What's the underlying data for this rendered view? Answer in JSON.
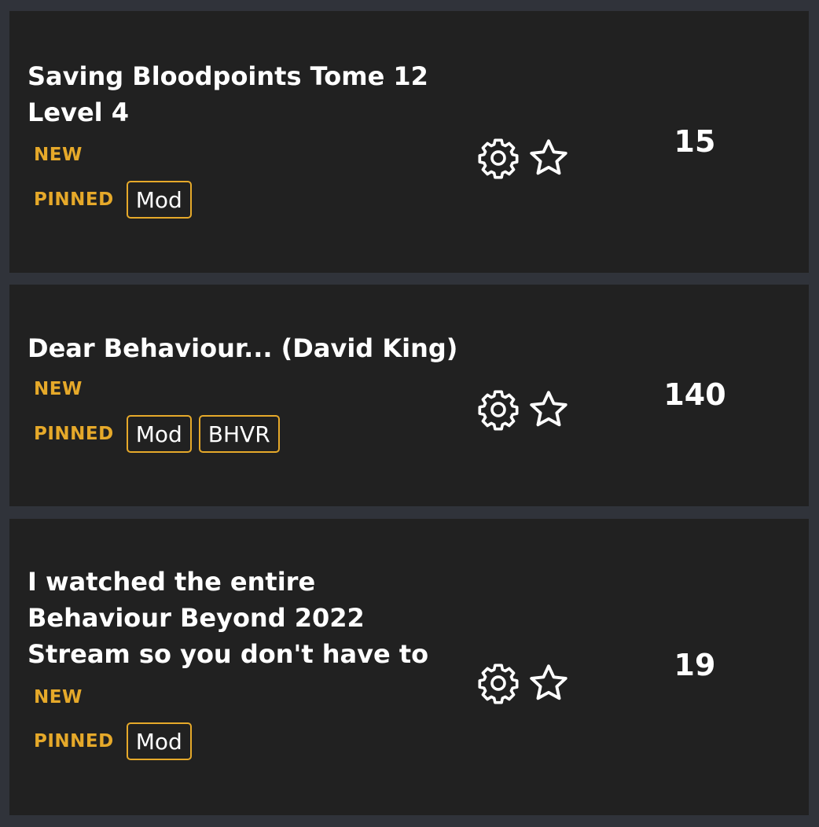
{
  "threads": [
    {
      "title": "Saving Bloodpoints Tome 12 Level 4",
      "new_label": "NEW",
      "pinned_label": "PINNED",
      "badges": [
        "Mod"
      ],
      "count": "15",
      "icons": [
        "gear-icon",
        "star-icon"
      ]
    },
    {
      "title": "Dear Behaviour... (David King)",
      "new_label": "NEW",
      "pinned_label": "PINNED",
      "badges": [
        "Mod",
        "BHVR"
      ],
      "count": "140",
      "icons": [
        "gear-icon",
        "star-icon"
      ]
    },
    {
      "title": "I watched the entire Behaviour Beyond 2022 Stream so you don't have to",
      "new_label": "NEW",
      "pinned_label": "PINNED",
      "badges": [
        "Mod"
      ],
      "count": "19",
      "icons": [
        "gear-icon",
        "star-icon"
      ]
    }
  ],
  "colors": {
    "page_background": "#30333a",
    "card_background": "#212121",
    "accent": "#e6a92a",
    "text": "#ffffff"
  }
}
